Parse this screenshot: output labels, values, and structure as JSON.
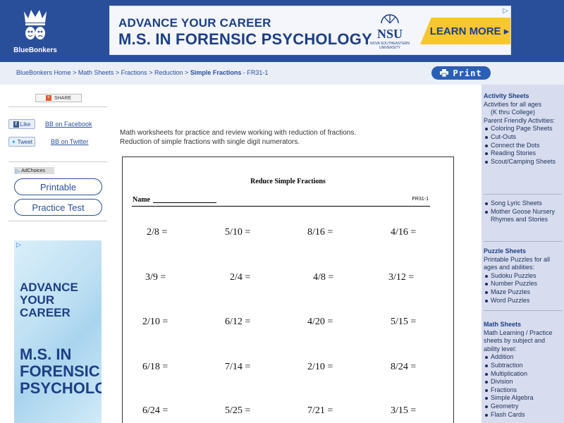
{
  "header": {
    "logo_text": "BlueBonkers",
    "banner": {
      "line1": "ADVANCE YOUR CAREER",
      "line2": "M.S. IN FORENSIC PSYCHOLOGY",
      "nsu": "NSU",
      "nsu_sub": "NOVA SOUTHEASTERN UNIVERSITY",
      "cta": "LEARN MORE ▸"
    }
  },
  "breadcrumb": {
    "items": [
      "BlueBonkers Home",
      "Math Sheets",
      "Fractions",
      "Reduction"
    ],
    "separator": ">",
    "current": "Simple Fractions",
    "code": " - FR31-1"
  },
  "print_label": "Print",
  "left": {
    "share": "SHARE",
    "like": "Like",
    "facebook": "BB on Facebook",
    "tweet": "Tweet",
    "twitter": "BB on Twitter",
    "adchoices": "AdChoices",
    "printable": "Printable",
    "practice": "Practice Test",
    "ad_line1": "ADVANCE YOUR CAREER",
    "ad_line2": "M.S. IN FORENSIC PSYCHOLOGY"
  },
  "intro": {
    "line1": "Math worksheets for practice and review working with reduction of fractions.",
    "line2": "Reduction of simple fractions with single digit numerators."
  },
  "worksheet": {
    "title": "Reduce Simple Fractions",
    "name_label": "Name",
    "code": "FR31-1",
    "rows": [
      [
        "2/8  =",
        "5/10  =",
        "8/16  =",
        "4/16  ="
      ],
      [
        "3/9   =",
        "2/4  =",
        "4/8  =",
        "3/12  ="
      ],
      [
        "2/10  =",
        "6/12  =",
        "4/20  =",
        "5/15  ="
      ],
      [
        "6/18  =",
        "7/14  =",
        "2/10  =",
        "8/24  ="
      ],
      [
        "6/24  =",
        "5/25  =",
        "7/21  =",
        "3/15  ="
      ]
    ]
  },
  "sidebar": {
    "activity": {
      "heading": "Activity Sheets",
      "desc1": "Activities for all ages",
      "desc2": "(K thru College)",
      "desc3": "Parent Friendly Activities:",
      "items": [
        "Coloring Page Sheets",
        "Cut-Outs",
        "Connect the Dots",
        "Reading Stories",
        "Scout/Camping Sheets"
      ],
      "items2": [
        "Song Lyric Sheets",
        "Mother Goose Nursery"
      ],
      "rhymes": "Rhymes and Stories"
    },
    "puzzle": {
      "heading": "Puzzle Sheets",
      "desc": "Printable Puzzles for all ages and abilities:",
      "items": [
        "Sudoku Puzzles",
        "Number Puzzles",
        "Maze Puzzles",
        "Word Puzzles"
      ]
    },
    "math": {
      "heading": "Math Sheets",
      "desc": "Math Learning / Practice sheets by subject and ability level:",
      "items": [
        "Addition",
        "Subtraction",
        "Multiplication",
        "Division",
        "Fractions",
        "Simple Algebra",
        "Geometry",
        "Flash Cards"
      ]
    }
  }
}
